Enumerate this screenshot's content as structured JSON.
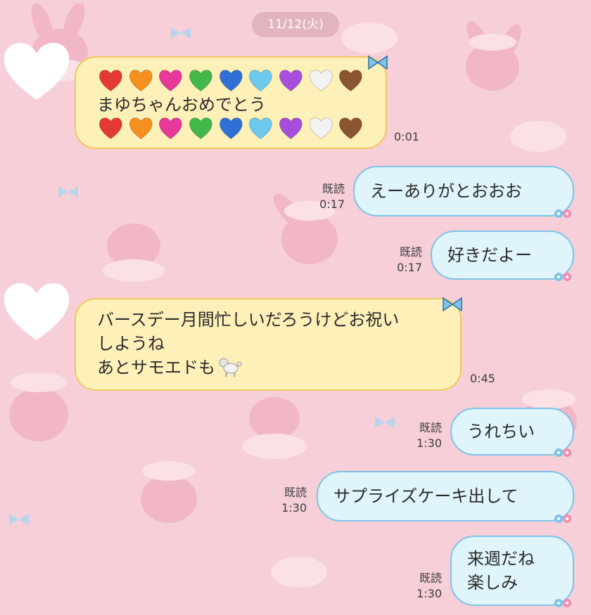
{
  "date_label": "11/12(火)",
  "heart_colors": [
    "#e53935",
    "#f5901e",
    "#e8399b",
    "#43b84a",
    "#2f6fd6",
    "#6dc8ef",
    "#a64fdc",
    "#f3f3f3",
    "#8a5430"
  ],
  "colors": {
    "background": "#f6cfd8",
    "incoming_fill": "#fdf0b8",
    "incoming_border": "#f0c85f",
    "outgoing_fill": "#dff4fb",
    "outgoing_border": "#7ec3e8"
  },
  "messages": [
    {
      "side": "incoming",
      "lines": [
        "",
        "まゆちゃんおめでとう",
        ""
      ],
      "time": "0:01"
    },
    {
      "side": "outgoing",
      "lines": [
        "えーありがとおおお"
      ],
      "read": "既読",
      "time": "0:17"
    },
    {
      "side": "outgoing",
      "lines": [
        "好きだよー"
      ],
      "read": "既読",
      "time": "0:17"
    },
    {
      "side": "incoming",
      "lines": [
        "バースデー月間忙しいだろうけどお祝い",
        "しようね",
        "あとサモエドも"
      ],
      "time": "0:45",
      "emoji": "poodle-icon"
    },
    {
      "side": "outgoing",
      "lines": [
        "うれちい"
      ],
      "read": "既読",
      "time": "1:30"
    },
    {
      "side": "outgoing",
      "lines": [
        "サプライズケーキ出して"
      ],
      "read": "既読",
      "time": "1:30"
    },
    {
      "side": "outgoing",
      "lines": [
        "来週だね",
        "楽しみ"
      ],
      "read": "既読",
      "time": "1:30"
    }
  ]
}
